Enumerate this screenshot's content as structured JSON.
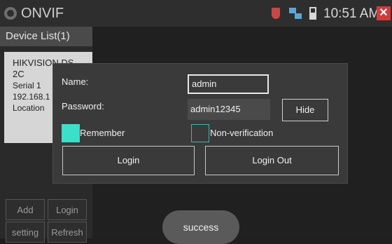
{
  "statusbar": {
    "title": "ONVIF",
    "time": "10:51 AM",
    "close_glyph": "✕",
    "icons": [
      "app-icon",
      "shield-icon",
      "network-icon",
      "battery-icon",
      "close-icon"
    ]
  },
  "device_list": {
    "header": "Device List(1)",
    "device": {
      "name": "HIKVISION DS-2C",
      "serial": "Serial  1",
      "ip": "192.168.1",
      "location": "Location"
    },
    "buttons": {
      "add": "Add",
      "login": "Login",
      "setting": "setting",
      "refresh": "Refresh"
    }
  },
  "login_dialog": {
    "name_label": "Name:",
    "name_value": "admin",
    "password_label": "Password:",
    "password_value": "admin12345",
    "hide_label": "Hide",
    "remember_label": "Remember",
    "remember_checked": true,
    "nonverification_label": "Non-verification",
    "nonverification_checked": false,
    "login_label": "Login",
    "logout_label": "Login Out"
  },
  "toast": {
    "text": "success"
  },
  "colors": {
    "accent_teal": "#3be0c8",
    "close_red": "#d33b3b",
    "dialog_bg": "#3a3a3a"
  }
}
